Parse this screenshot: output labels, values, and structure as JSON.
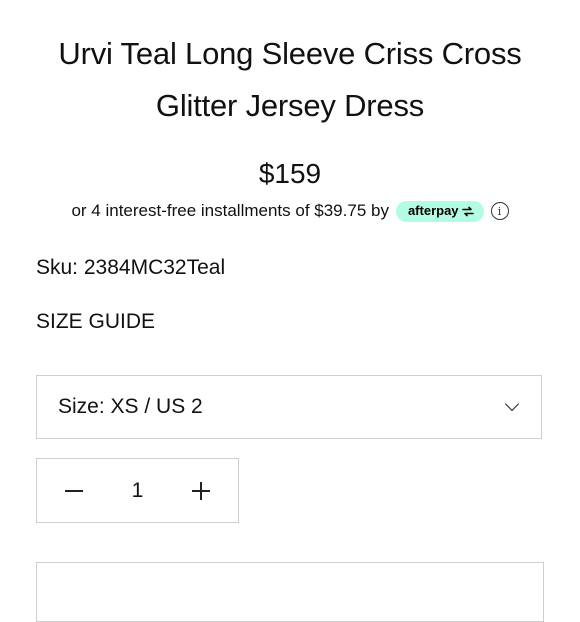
{
  "product": {
    "title": "Urvi Teal Long Sleeve Criss Cross Glitter Jersey Dress",
    "price": "$159",
    "sku_label": "Sku: 2384MC32Teal"
  },
  "afterpay": {
    "installments_text": "or 4 interest-free installments of $39.75 by",
    "brand_label": "afterpay",
    "info_icon_glyph": "i",
    "badge_color": "#b2fce4"
  },
  "size_guide": {
    "label": "SIZE GUIDE"
  },
  "size_select": {
    "selected_label": "Size: XS / US 2",
    "icon": "chevron-down-icon"
  },
  "quantity": {
    "value": "1",
    "decrement_icon": "minus-icon",
    "increment_icon": "plus-icon"
  }
}
